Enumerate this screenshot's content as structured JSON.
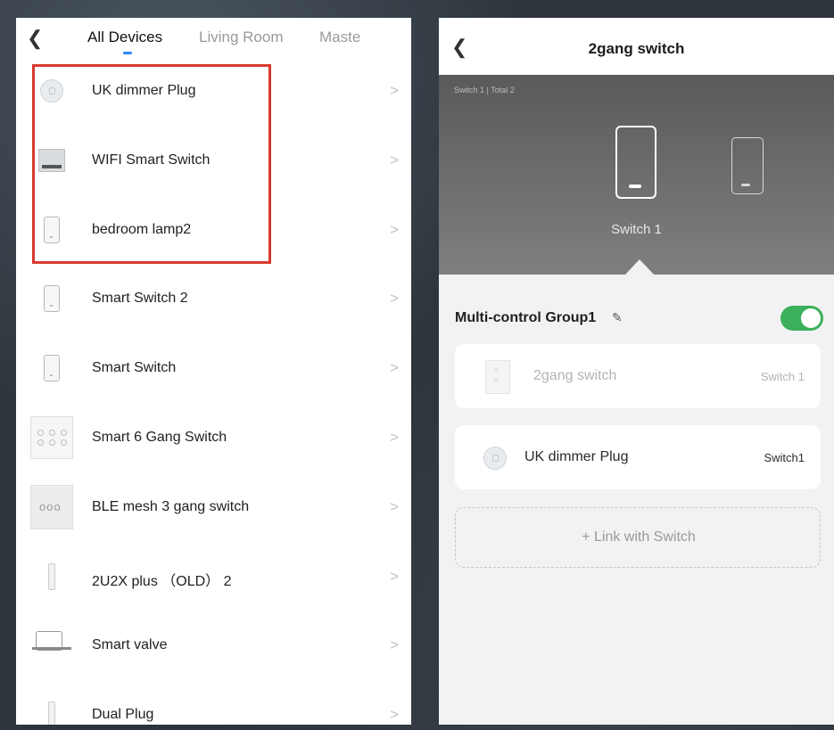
{
  "left_panel": {
    "tabs": [
      "All Devices",
      "Living Room",
      "Maste"
    ],
    "active_tab": "All Devices",
    "devices": [
      {
        "name": "UK dimmer Plug",
        "icon": "plug-icon"
      },
      {
        "name": "WIFI Smart Switch",
        "icon": "switch-module-icon"
      },
      {
        "name": "bedroom lamp2",
        "icon": "wall-switch-icon"
      },
      {
        "name": "Smart Switch  2",
        "icon": "wall-switch-icon"
      },
      {
        "name": "Smart Switch",
        "icon": "wall-switch-icon"
      },
      {
        "name": "Smart 6 Gang Switch",
        "icon": "six-gang-switch-icon"
      },
      {
        "name": "BLE mesh 3 gang switch",
        "icon": "three-gang-switch-icon"
      },
      {
        "name": "2U2X plus （OLD） 2",
        "icon": "power-strip-icon"
      },
      {
        "name": "Smart valve",
        "icon": "valve-icon"
      },
      {
        "name": "Dual Plug",
        "icon": "power-strip-icon"
      }
    ],
    "chevron": ">",
    "highlight_color": "#d83a2e"
  },
  "right_panel": {
    "title": "2gang switch",
    "switch_index": "Switch 1 | Total 2",
    "selected_switch": "Switch 1",
    "group": {
      "name": "Multi-control Group1",
      "enabled": true,
      "toggle_color": "#3cb05b"
    },
    "linked_devices": [
      {
        "name": "2gang switch",
        "channel": "Switch 1",
        "faded": true
      },
      {
        "name": "UK dimmer Plug",
        "channel": "Switch1",
        "faded": false
      }
    ],
    "link_button": "+   Link with Switch"
  }
}
